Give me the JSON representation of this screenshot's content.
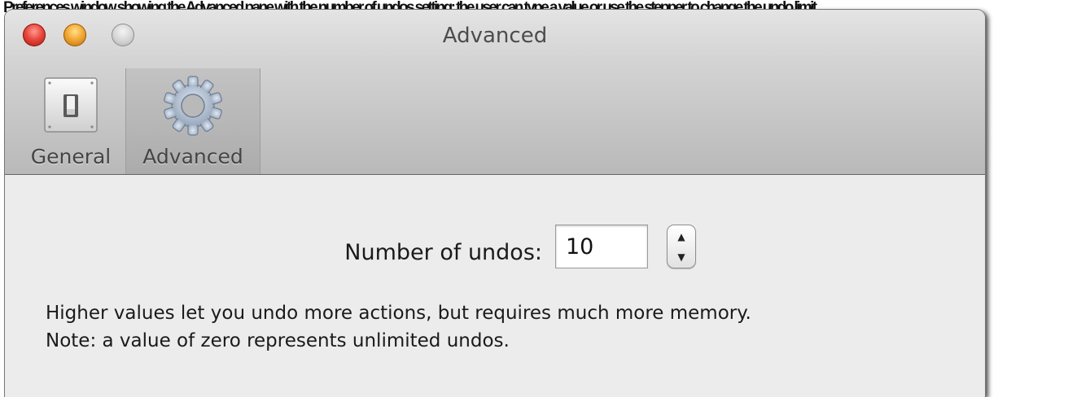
{
  "background_caption": "Preferences window showing the Advanced pane with the number of undos setting; the user can type a value or use the stepper to change the undo limit",
  "window": {
    "title": "Advanced",
    "controls": [
      "close",
      "minimize",
      "zoom"
    ]
  },
  "toolbar": {
    "tabs": [
      {
        "label": "General",
        "icon": "switch-icon",
        "selected": false
      },
      {
        "label": "Advanced",
        "icon": "gear-icon",
        "selected": true
      }
    ]
  },
  "undos": {
    "label": "Number of undos:",
    "value": "10"
  },
  "help": {
    "line1": "Higher values let you undo more actions, but requires much more memory.",
    "line2": "Note: a value of zero represents unlimited undos."
  },
  "colors": {
    "close": "#e8453b",
    "minimize": "#f1a734",
    "zoom": "#d2d2d2",
    "window_bg": "#ececec"
  }
}
